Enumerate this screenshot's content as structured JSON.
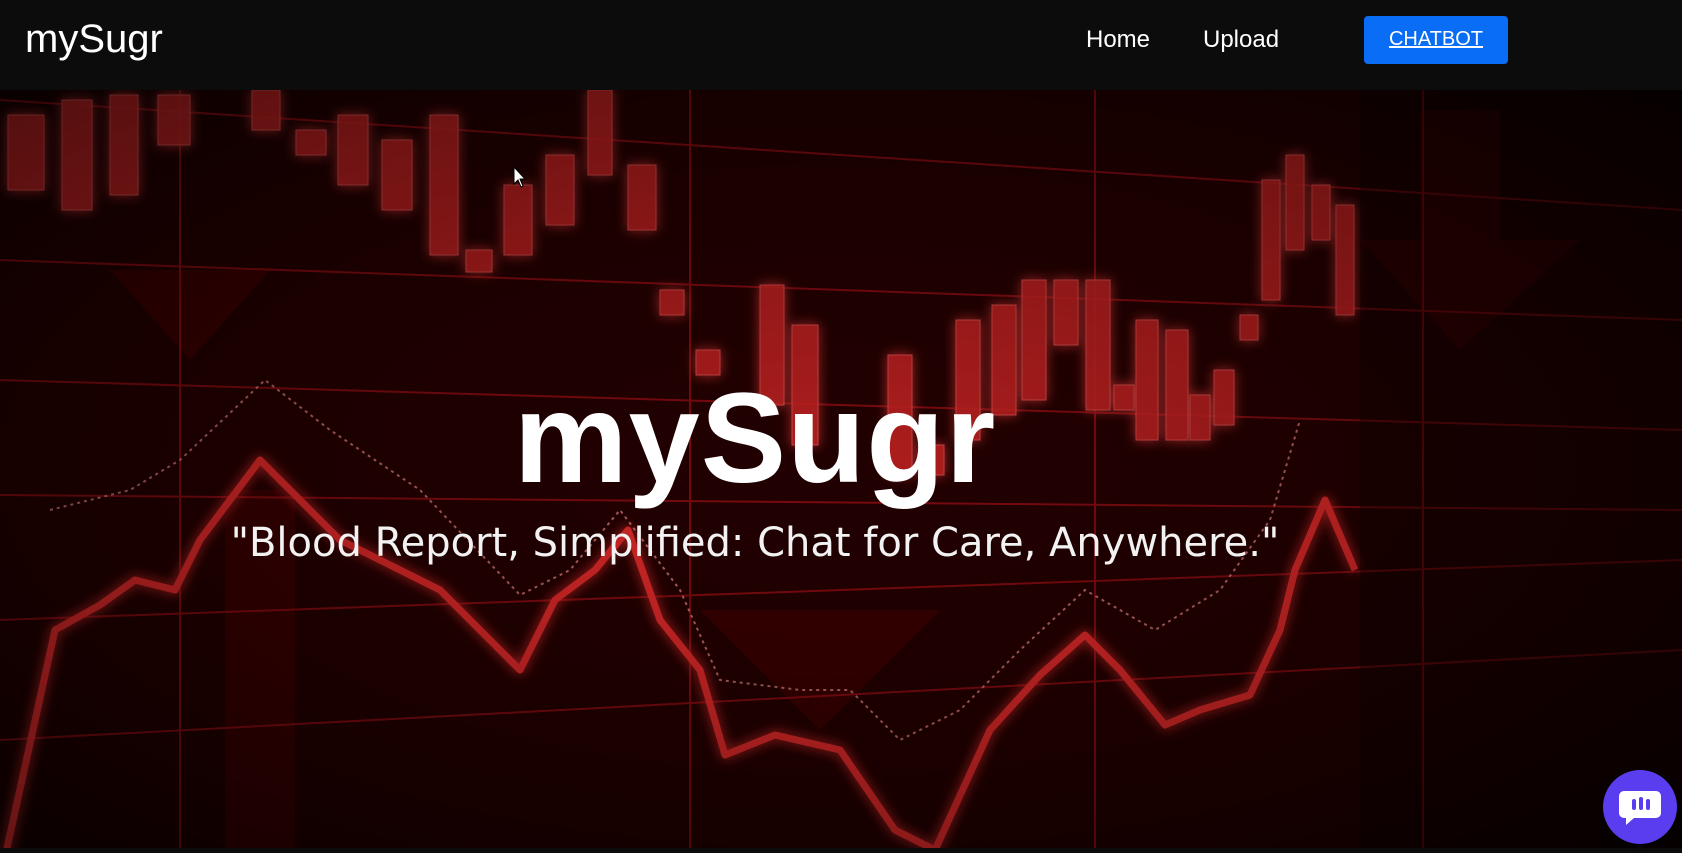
{
  "navbar": {
    "brand": "mySugr",
    "links": [
      {
        "label": "Home"
      },
      {
        "label": "Upload"
      }
    ],
    "cta_label": "CHATBOT"
  },
  "hero": {
    "title": "mySugr",
    "subtitle": "\"Blood Report, Simplified: Chat for Care, Anywhere.\"",
    "background": "red-stock-candlestick-chart-image"
  },
  "chat_widget": {
    "icon": "chat-bubble-icon"
  },
  "colors": {
    "navbar_bg": "#0c0c0c",
    "cta_bg": "#0a6df5",
    "hero_red": "#e01414",
    "chat_widget_bg": "#5b3df0"
  }
}
